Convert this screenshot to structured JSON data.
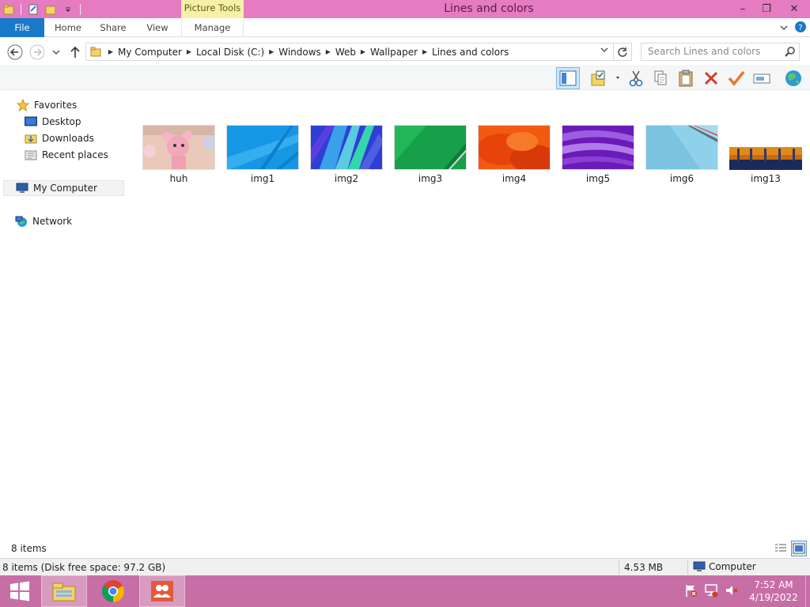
{
  "window": {
    "title": "Lines and colors",
    "context_tab": "Picture Tools",
    "minimize_glyph": "–",
    "restore_glyph": "❐",
    "close_glyph": "✕"
  },
  "ribbon": {
    "tabs": [
      "File",
      "Home",
      "Share",
      "View",
      "Manage"
    ]
  },
  "address": {
    "crumbs": [
      "My Computer",
      "Local Disk (C:)",
      "Windows",
      "Web",
      "Wallpaper",
      "Lines and colors"
    ],
    "search_placeholder": "Search Lines and colors"
  },
  "nav": {
    "favorites": "Favorites",
    "desktop": "Desktop",
    "downloads": "Downloads",
    "recent": "Recent places",
    "computer": "My Computer",
    "network": "Network"
  },
  "files": [
    {
      "name": "huh"
    },
    {
      "name": "img1"
    },
    {
      "name": "img2"
    },
    {
      "name": "img3"
    },
    {
      "name": "img4"
    },
    {
      "name": "img5"
    },
    {
      "name": "img6"
    },
    {
      "name": "img13"
    }
  ],
  "status": {
    "count": "8 items",
    "summary": "8 items (Disk free space: 97.2 GB)",
    "size": "4.53 MB",
    "location": "Computer"
  },
  "taskbar": {
    "time": "7:52 AM",
    "date": "4/19/2022"
  },
  "colors": {
    "title_bar": "#e57bc0",
    "taskbar": "#c86ea7",
    "file_tab": "#1979ca",
    "context_tab": "#f6f0a9"
  }
}
